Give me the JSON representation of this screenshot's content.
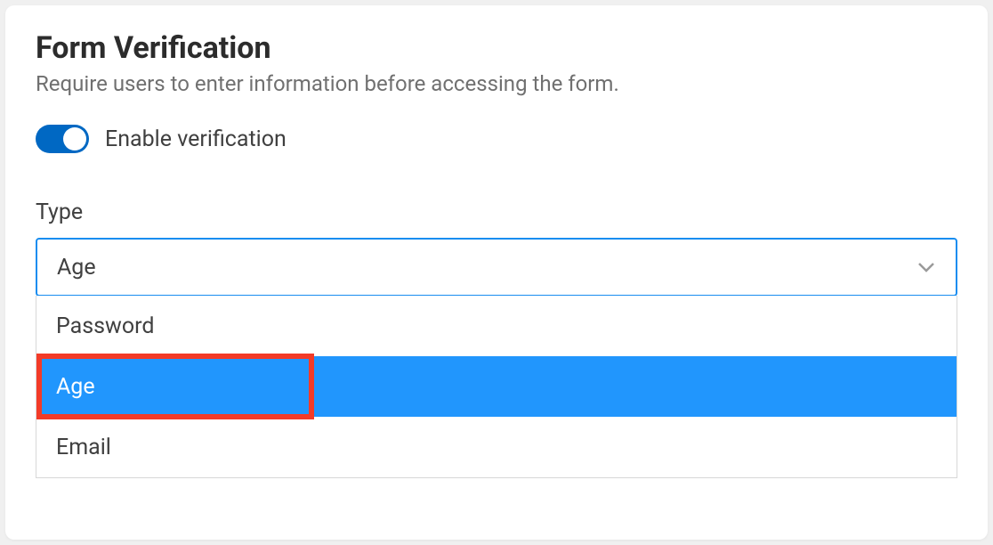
{
  "header": {
    "title": "Form Verification",
    "subtitle": "Require users to enter information before accessing the form."
  },
  "toggle": {
    "label": "Enable verification",
    "enabled": true
  },
  "typeField": {
    "label": "Type",
    "selected": "Age",
    "options": [
      {
        "label": "Password",
        "selected": false
      },
      {
        "label": "Age",
        "selected": true
      },
      {
        "label": "Email",
        "selected": false
      }
    ]
  }
}
